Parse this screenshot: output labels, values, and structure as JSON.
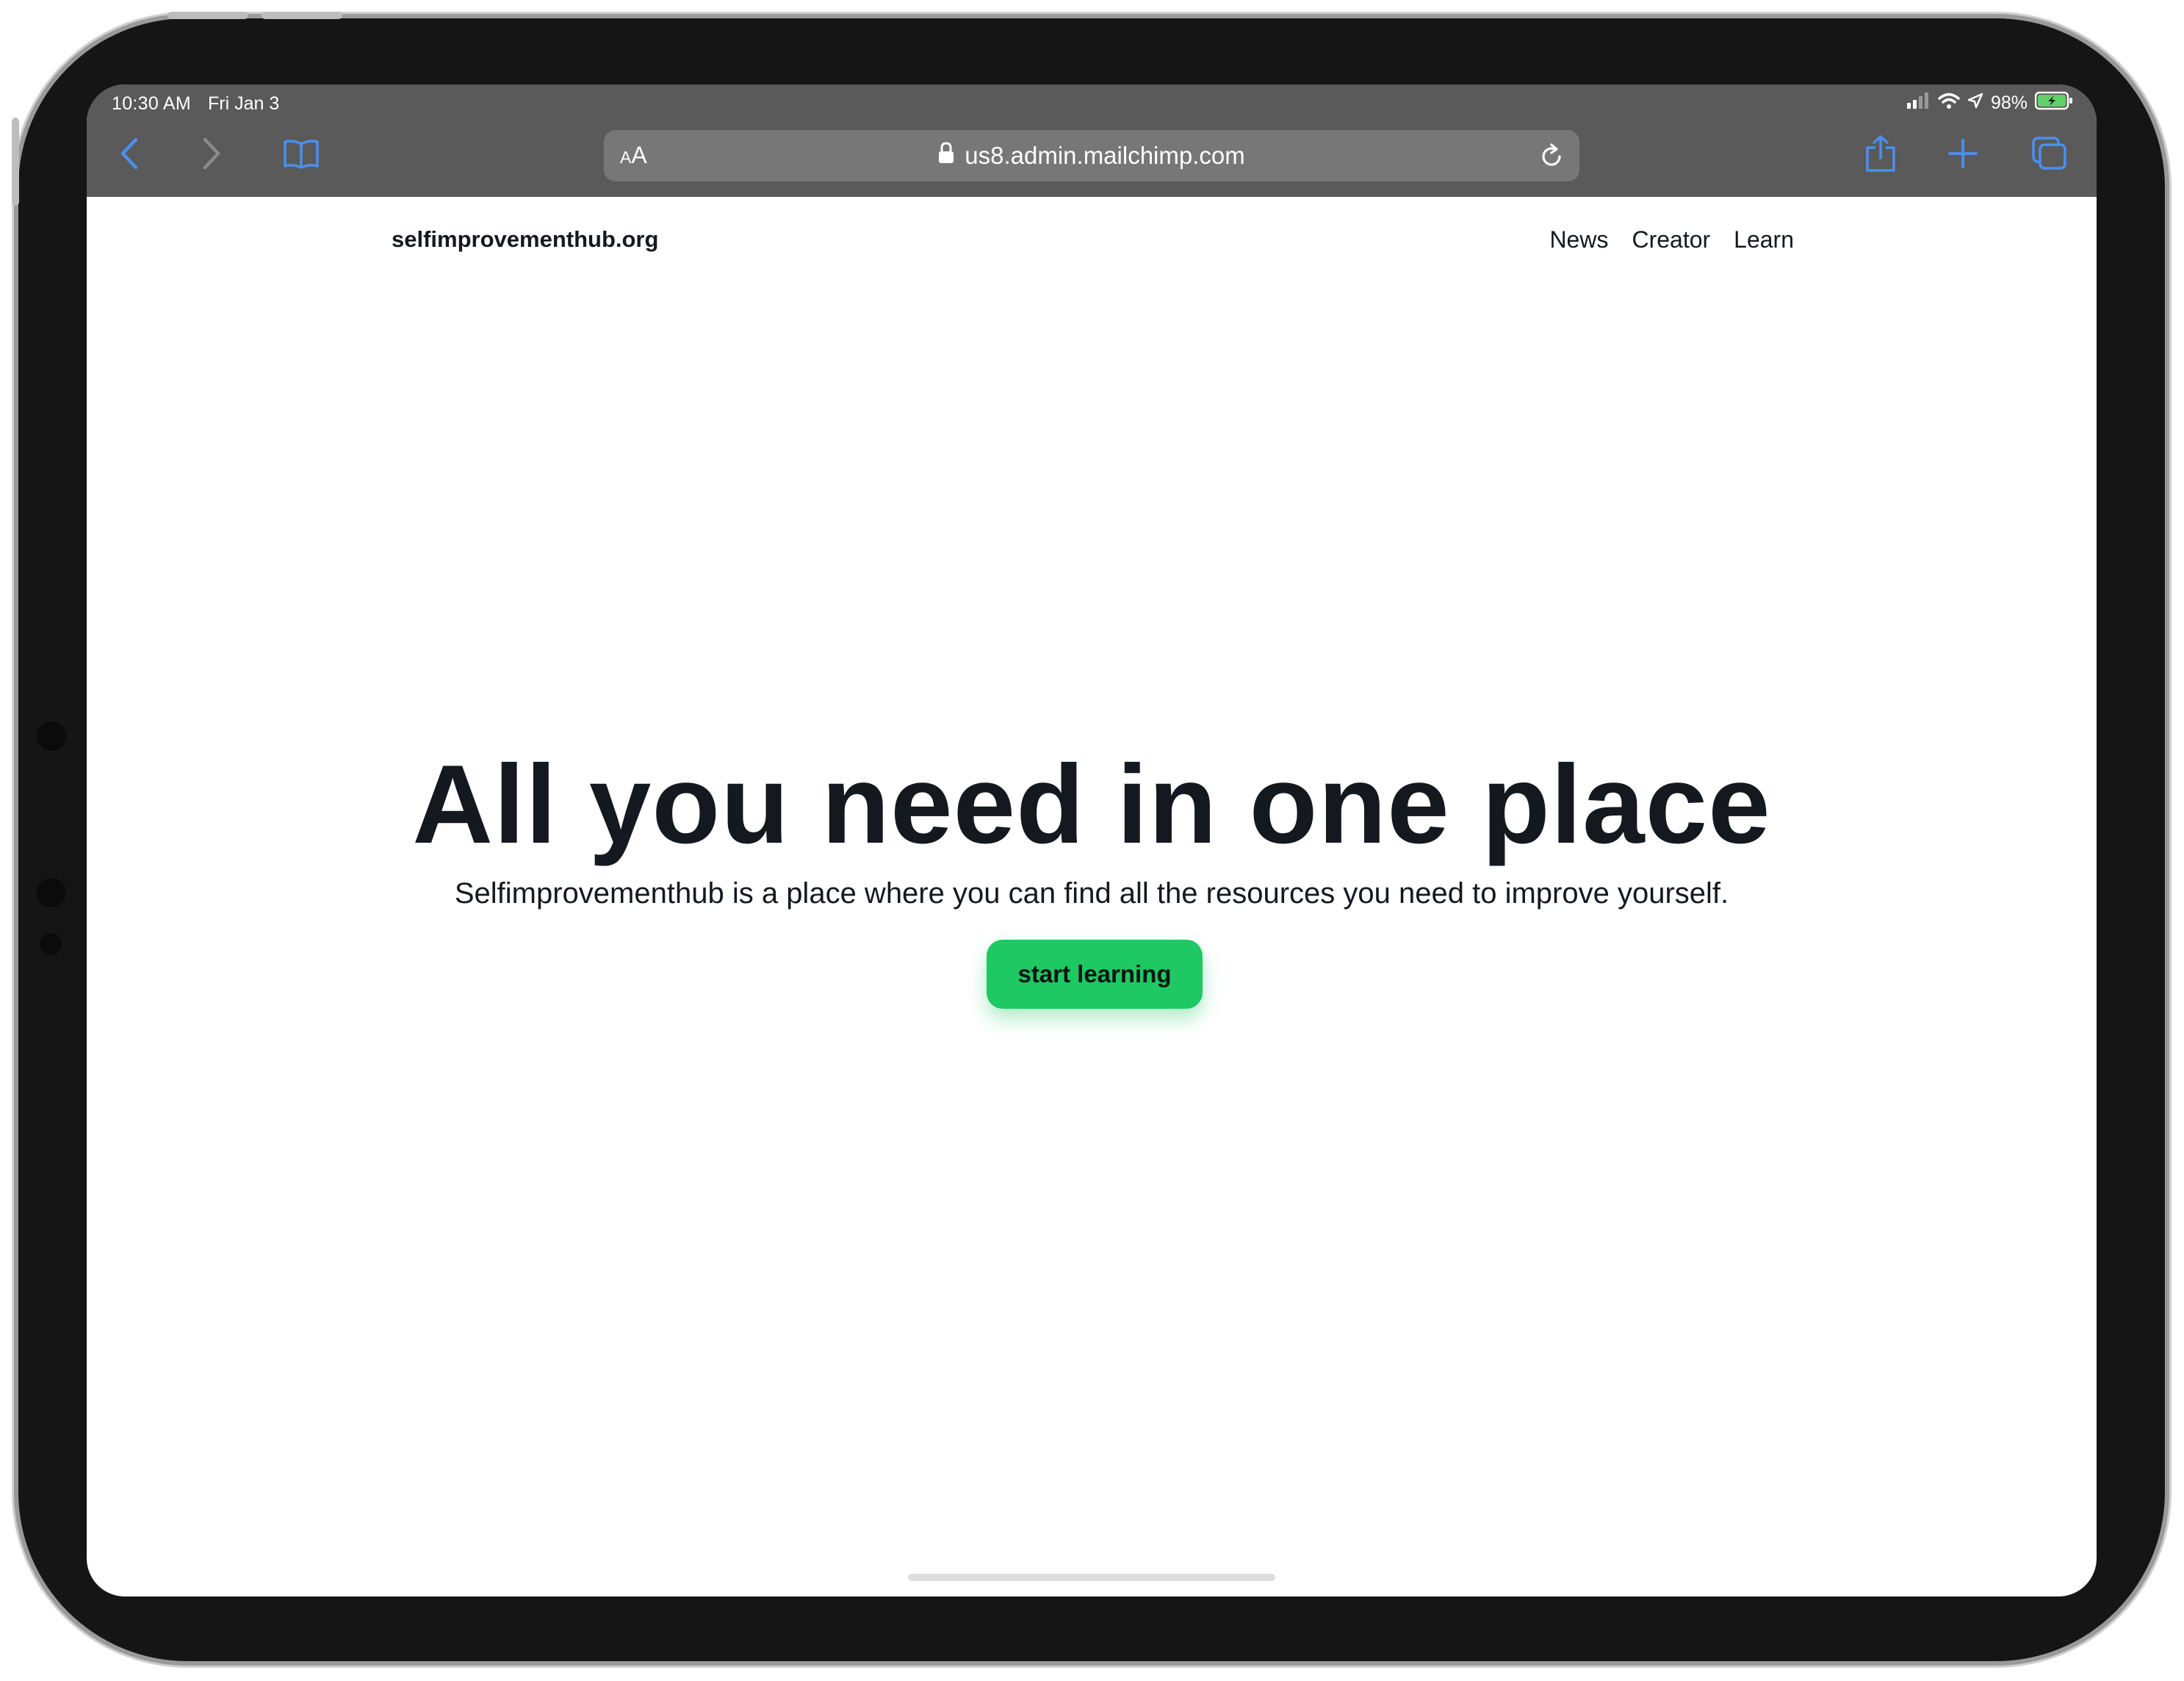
{
  "status_bar": {
    "time": "10:30 AM",
    "date": "Fri Jan 3",
    "battery": "98%"
  },
  "browser": {
    "text_size_label": "AA",
    "url": "us8.admin.mailchimp.com",
    "icons": {
      "back": "chevron-left-icon",
      "forward": "chevron-right-icon",
      "bookmarks": "book-icon",
      "share": "share-icon",
      "new_tab": "plus-icon",
      "tabs": "tabs-icon",
      "reload": "reload-icon",
      "lock": "lock-icon"
    },
    "accent_color": "#4a90f0"
  },
  "site": {
    "brand": "selfimprovementhub.org",
    "nav": [
      "News",
      "Creator",
      "Learn"
    ]
  },
  "hero": {
    "title": "All you need in one place",
    "subtitle": "Selfimprovementhub is a place where you can find all the resources you need to improve yourself.",
    "cta_label": "start learning",
    "cta_color": "#1ec863"
  }
}
